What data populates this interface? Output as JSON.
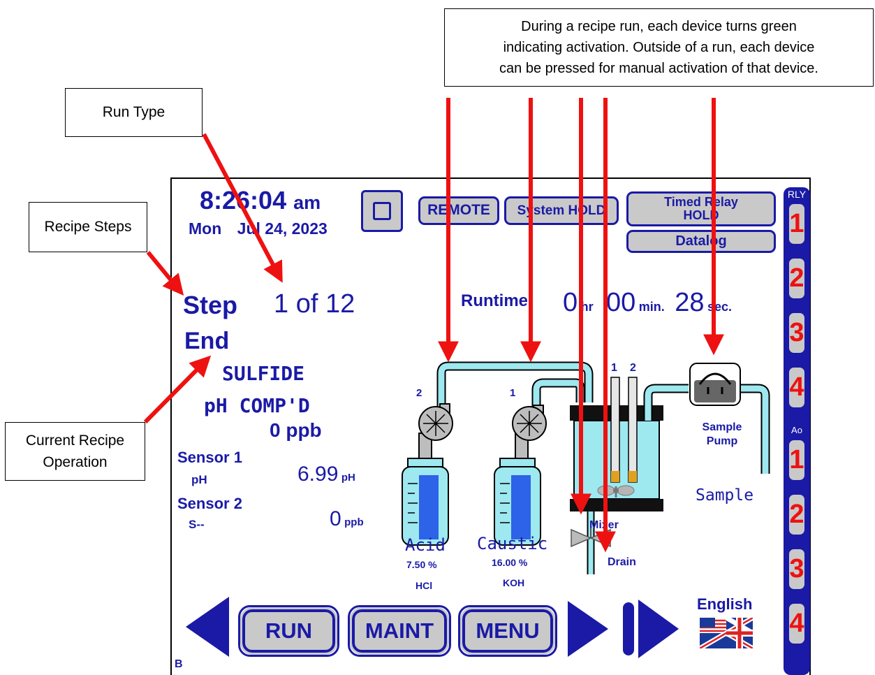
{
  "callouts": {
    "run_type": "Run Type",
    "recipe_steps": "Recipe Steps",
    "current_recipe_operation_1": "Current Recipe",
    "current_recipe_operation_2": "Operation",
    "device_note_1": "During a recipe run, each device turns green",
    "device_note_2": "indicating activation. Outside of a run, each device",
    "device_note_3": "can be pressed for manual activation of that device."
  },
  "header": {
    "time": "8:26:04",
    "ampm": "am",
    "day": "Mon",
    "date": "Jul 24, 2023",
    "remote": "REMOTE",
    "system_hold": "System HOLD",
    "timed_relay_1": "Timed Relay",
    "timed_relay_2": "HOLD",
    "datalog": "Datalog"
  },
  "status": {
    "step_label": "Step",
    "step_value": "1 of 12",
    "runtime_label": "Runtime",
    "hours": "0",
    "hr_unit": "hr",
    "minutes": "00",
    "min_unit": "min.",
    "seconds": "28",
    "sec_unit": "sec.",
    "run_type": "End",
    "operation_1": "SULFIDE",
    "operation_2": "pH COMP'D",
    "operation_3": "0 ppb"
  },
  "sensors": {
    "s1_name": "Sensor 1",
    "s1_type": "pH",
    "s1_value": "6.99",
    "s1_unit": "pH",
    "s2_name": "Sensor 2",
    "s2_type": "S--",
    "s2_value": "0",
    "s2_unit": "ppb"
  },
  "devices": {
    "pump_acid_num": "2",
    "pump_caustic_num": "1",
    "probe_1": "1",
    "probe_2": "2",
    "acid_label": "Acid",
    "acid_pct": "7.50 %",
    "acid_chem": "HCl",
    "caustic_label": "Caustic",
    "caustic_pct": "16.00 %",
    "caustic_chem": "KOH",
    "sample_pump_1": "Sample",
    "sample_pump_2": "Pump",
    "sample": "Sample",
    "mixer": "Mixer",
    "drain": "Drain"
  },
  "nav": {
    "run": "RUN",
    "maint": "MAINT",
    "menu": "MENU",
    "language": "English",
    "corner": "B"
  },
  "side": {
    "rly_label": "RLY",
    "ao_label": "Ao",
    "rly": [
      "1",
      "2",
      "3",
      "4"
    ],
    "ao": [
      "1",
      "2",
      "3",
      "4"
    ]
  },
  "colors": {
    "accent": "#1a1aa6",
    "button_fill": "#c9c9c9",
    "relay_digit": "#ee1111",
    "arrow": "#ee1111",
    "fluid": "#9ee8f0"
  }
}
